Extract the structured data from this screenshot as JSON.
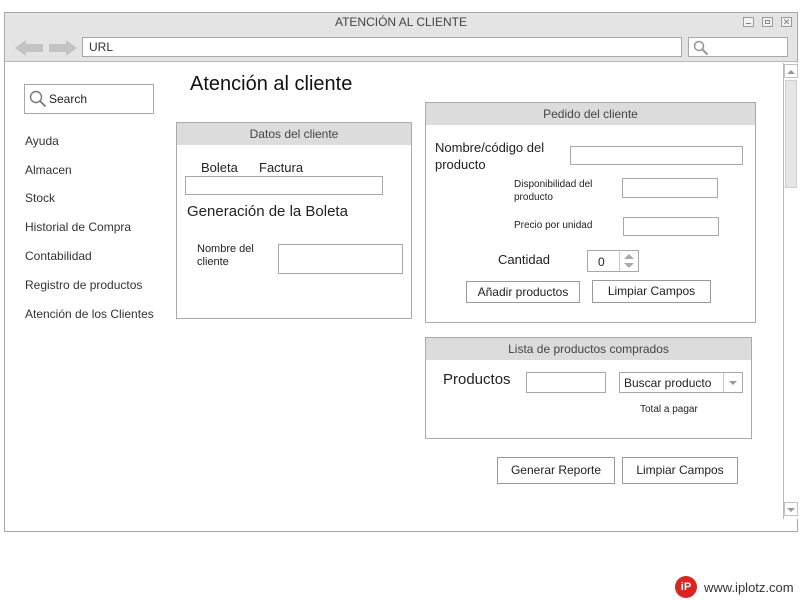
{
  "window": {
    "title": "ATENCIÓN AL CLIENTE",
    "url": "URL"
  },
  "sidebar": {
    "search_label": "Search",
    "items": [
      {
        "label": "Ayuda"
      },
      {
        "label": "Almacen"
      },
      {
        "label": "Stock"
      },
      {
        "label": "Historial de Compra"
      },
      {
        "label": "Contabilidad"
      },
      {
        "label": "Registro de productos"
      },
      {
        "label": "Atención de los Clientes"
      }
    ]
  },
  "page": {
    "title": "Atención al cliente"
  },
  "datos_cliente": {
    "header": "Datos del cliente",
    "tab_boleta": "Boleta",
    "tab_factura": "Factura",
    "section_title": "Generación de la Boleta",
    "nombre_label_1": "Nombre del",
    "nombre_label_2": "cliente",
    "doc_field_value": "",
    "nombre_value": ""
  },
  "pedido": {
    "header": "Pedido del cliente",
    "producto_label_1": "Nombre/código del",
    "producto_label_2": "producto",
    "disponibilidad_label_1": "Disponibilidad del",
    "disponibilidad_label_2": "producto",
    "precio_label": "Precio por unidad",
    "cantidad_label": "Cantidad",
    "cantidad_value": "0",
    "add_button": "Añadir productos",
    "clear_button": "Limpiar Campos"
  },
  "lista": {
    "header": "Lista de productos comprados",
    "productos_label": "Productos",
    "buscar_selected": "Buscar producto",
    "total_label": "Total a pagar"
  },
  "actions": {
    "report_button": "Generar Reporte",
    "clear_button": "Limpiar Campos"
  },
  "footer": {
    "logo_text": "iP",
    "site": "www.iplotz.com",
    "brand_color": "#d9241f"
  }
}
